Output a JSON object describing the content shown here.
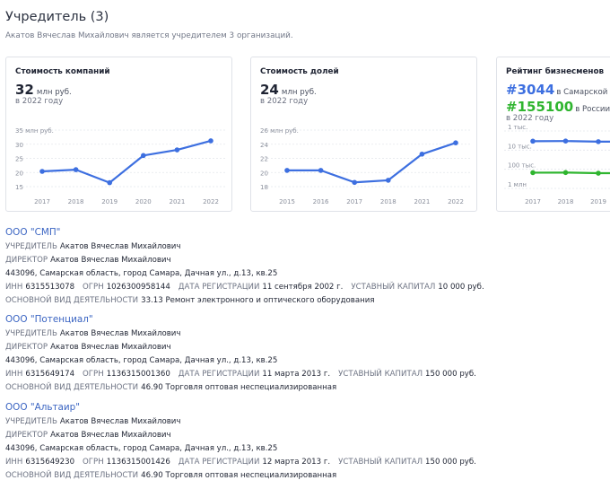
{
  "header": {
    "title": "Учредитель (3)",
    "subtitle": "Акатов Вячеслав Михайлович является учредителем 3 организаций."
  },
  "cards": [
    {
      "title": "Стоимость компаний",
      "value": "32",
      "unit": "млн руб.",
      "period": "в 2022 году",
      "chart_data": {
        "type": "line",
        "y_unit_label": "35 млн руб.",
        "yticks": [
          15,
          20,
          25,
          30,
          35
        ],
        "ylim": [
          15,
          35
        ],
        "x": [
          "2017",
          "2018",
          "2019",
          "2020",
          "2021",
          "2022"
        ],
        "values": [
          20.4,
          21,
          16.4,
          26,
          28,
          31.2
        ],
        "color": "#3d6fe0"
      }
    },
    {
      "title": "Стоимость долей",
      "value": "24",
      "unit": "млн руб.",
      "period": "в 2022 году",
      "chart_data": {
        "type": "line",
        "y_unit_label": "26 млн руб.",
        "yticks": [
          18,
          20,
          22,
          24,
          26
        ],
        "ylim": [
          18,
          26
        ],
        "x": [
          "2015",
          "2016",
          "2017",
          "2018",
          "2021",
          "2022"
        ],
        "values": [
          20.3,
          20.3,
          18.6,
          18.9,
          22.6,
          24.2
        ],
        "color": "#3d6fe0"
      }
    },
    {
      "title": "Рейтинг бизнесменов",
      "rank_region_hash": "#3044",
      "rank_region_text": "в Самарской об",
      "rank_country_hash": "#155100",
      "rank_country_text": "в России",
      "period": "в 2022 году",
      "chart_data": {
        "type": "line",
        "y_labels": [
          "1 тыс.",
          "10 тыс.",
          "100 тыс.",
          "1 млн"
        ],
        "y_scale": "log",
        "x": [
          "2017",
          "2018",
          "2019"
        ],
        "series": [
          {
            "values": [
              3400,
              3350,
              3600,
              3600
            ],
            "color": "#3d6fe0"
          },
          {
            "values": [
              150000,
              148000,
              160000,
              160000
            ],
            "color": "#2fb52f"
          }
        ]
      }
    }
  ],
  "organizations": [
    {
      "name": "ООО \"СМП\"",
      "founder_label": "УЧРЕДИТЕЛЬ",
      "founder": "Акатов Вячеслав Михайлович",
      "director_label": "ДИРЕКТОР",
      "director": "Акатов Вячеслав Михайлович",
      "address": "443096, Самарская область, город Самара, Дачная ул., д.13, кв.25",
      "inn_label": "ИНН",
      "inn": "6315513078",
      "ogrn_label": "ОГРН",
      "ogrn": "1026300958144",
      "reg_label": "ДАТА РЕГИСТРАЦИИ",
      "reg": "11 сентября 2002 г.",
      "capital_label": "УСТАВНЫЙ КАПИТАЛ",
      "capital": "10 000 руб.",
      "activity_label": "ОСНОВНОЙ ВИД ДЕЯТЕЛЬНОСТИ",
      "activity": "33.13 Ремонт электронного и оптического оборудования"
    },
    {
      "name": "ООО \"Потенциал\"",
      "founder_label": "УЧРЕДИТЕЛЬ",
      "founder": "Акатов Вячеслав Михайлович",
      "director_label": "ДИРЕКТОР",
      "director": "Акатов Вячеслав Михайлович",
      "address": "443096, Самарская область, город Самара, Дачная ул., д.13, кв.25",
      "inn_label": "ИНН",
      "inn": "6315649174",
      "ogrn_label": "ОГРН",
      "ogrn": "1136315001360",
      "reg_label": "ДАТА РЕГИСТРАЦИИ",
      "reg": "11 марта 2013 г.",
      "capital_label": "УСТАВНЫЙ КАПИТАЛ",
      "capital": "150 000 руб.",
      "activity_label": "ОСНОВНОЙ ВИД ДЕЯТЕЛЬНОСТИ",
      "activity": "46.90 Торговля оптовая неспециализированная"
    },
    {
      "name": "ООО \"Альтаир\"",
      "founder_label": "УЧРЕДИТЕЛЬ",
      "founder": "Акатов Вячеслав Михайлович",
      "director_label": "ДИРЕКТОР",
      "director": "Акатов Вячеслав Михайлович",
      "address": "443096, Самарская область, город Самара, Дачная ул., д.13, кв.25",
      "inn_label": "ИНН",
      "inn": "6315649230",
      "ogrn_label": "ОГРН",
      "ogrn": "1136315001426",
      "reg_label": "ДАТА РЕГИСТРАЦИИ",
      "reg": "12 марта 2013 г.",
      "capital_label": "УСТАВНЫЙ КАПИТАЛ",
      "capital": "150 000 руб.",
      "activity_label": "ОСНОВНОЙ ВИД ДЕЯТЕЛЬНОСТИ",
      "activity": "46.90 Торговля оптовая неспециализированная"
    }
  ]
}
